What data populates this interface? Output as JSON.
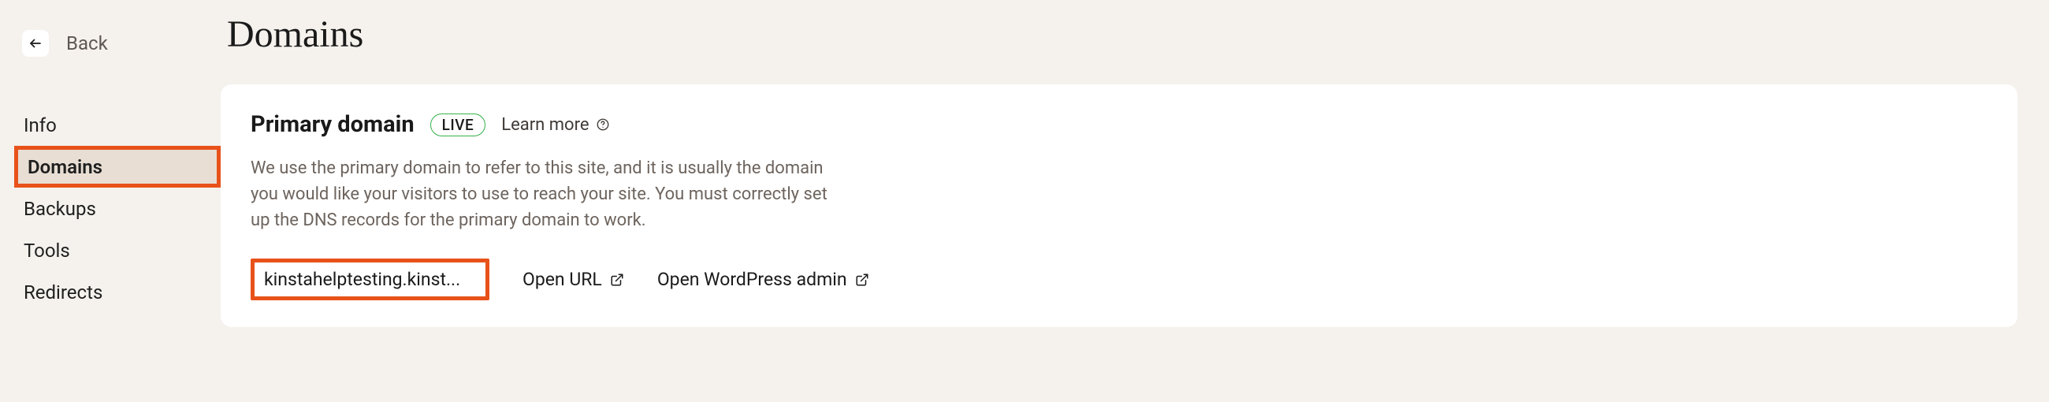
{
  "back": {
    "label": "Back"
  },
  "sidebar": {
    "items": [
      {
        "label": "Info",
        "active": false
      },
      {
        "label": "Domains",
        "active": true
      },
      {
        "label": "Backups",
        "active": false
      },
      {
        "label": "Tools",
        "active": false
      },
      {
        "label": "Redirects",
        "active": false
      }
    ]
  },
  "page": {
    "title": "Domains"
  },
  "card": {
    "title": "Primary domain",
    "badge": "LIVE",
    "learn_more": "Learn more",
    "description": "We use the primary domain to refer to this site, and it is usually the domain you would like your visitors to use to reach your site. You must correctly set up the DNS records for the primary domain to work.",
    "domain_value": "kinstahelptesting.kinst...",
    "open_url": "Open URL",
    "open_wp": "Open WordPress admin"
  }
}
